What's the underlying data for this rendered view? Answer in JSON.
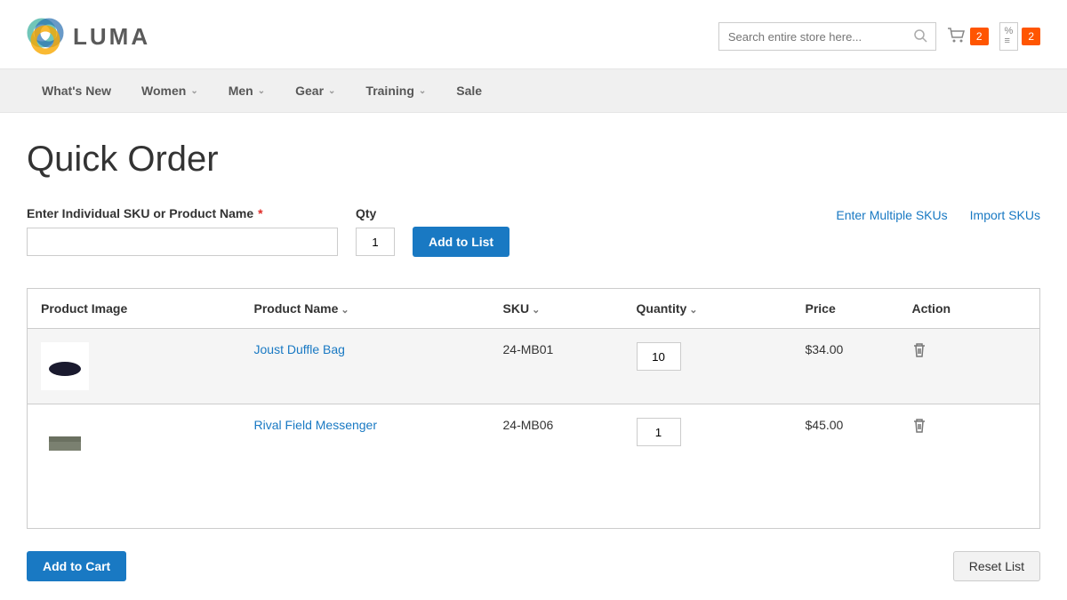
{
  "header": {
    "brand": "LUMA",
    "search_placeholder": "Search entire store here...",
    "cart_count": "2",
    "compare_count": "2"
  },
  "nav": {
    "items": [
      {
        "label": "What's New",
        "has_children": false
      },
      {
        "label": "Women",
        "has_children": true
      },
      {
        "label": "Men",
        "has_children": true
      },
      {
        "label": "Gear",
        "has_children": true
      },
      {
        "label": "Training",
        "has_children": true
      },
      {
        "label": "Sale",
        "has_children": false
      }
    ]
  },
  "page": {
    "title": "Quick Order",
    "sku_label": "Enter Individual SKU or Product Name",
    "qty_label": "Qty",
    "qty_value": "1",
    "add_to_list": "Add to List",
    "link_multiple": "Enter Multiple SKUs",
    "link_import": "Import SKUs"
  },
  "table": {
    "headers": {
      "image": "Product Image",
      "name": "Product Name",
      "sku": "SKU",
      "qty": "Quantity",
      "price": "Price",
      "action": "Action"
    },
    "rows": [
      {
        "name": "Joust Duffle Bag",
        "sku": "24-MB01",
        "qty": "10",
        "price": "$34.00",
        "thumb": "duffle"
      },
      {
        "name": "Rival Field Messenger",
        "sku": "24-MB06",
        "qty": "1",
        "price": "$45.00",
        "thumb": "messenger"
      }
    ]
  },
  "actions": {
    "add_to_cart": "Add to Cart",
    "reset_list": "Reset List"
  }
}
